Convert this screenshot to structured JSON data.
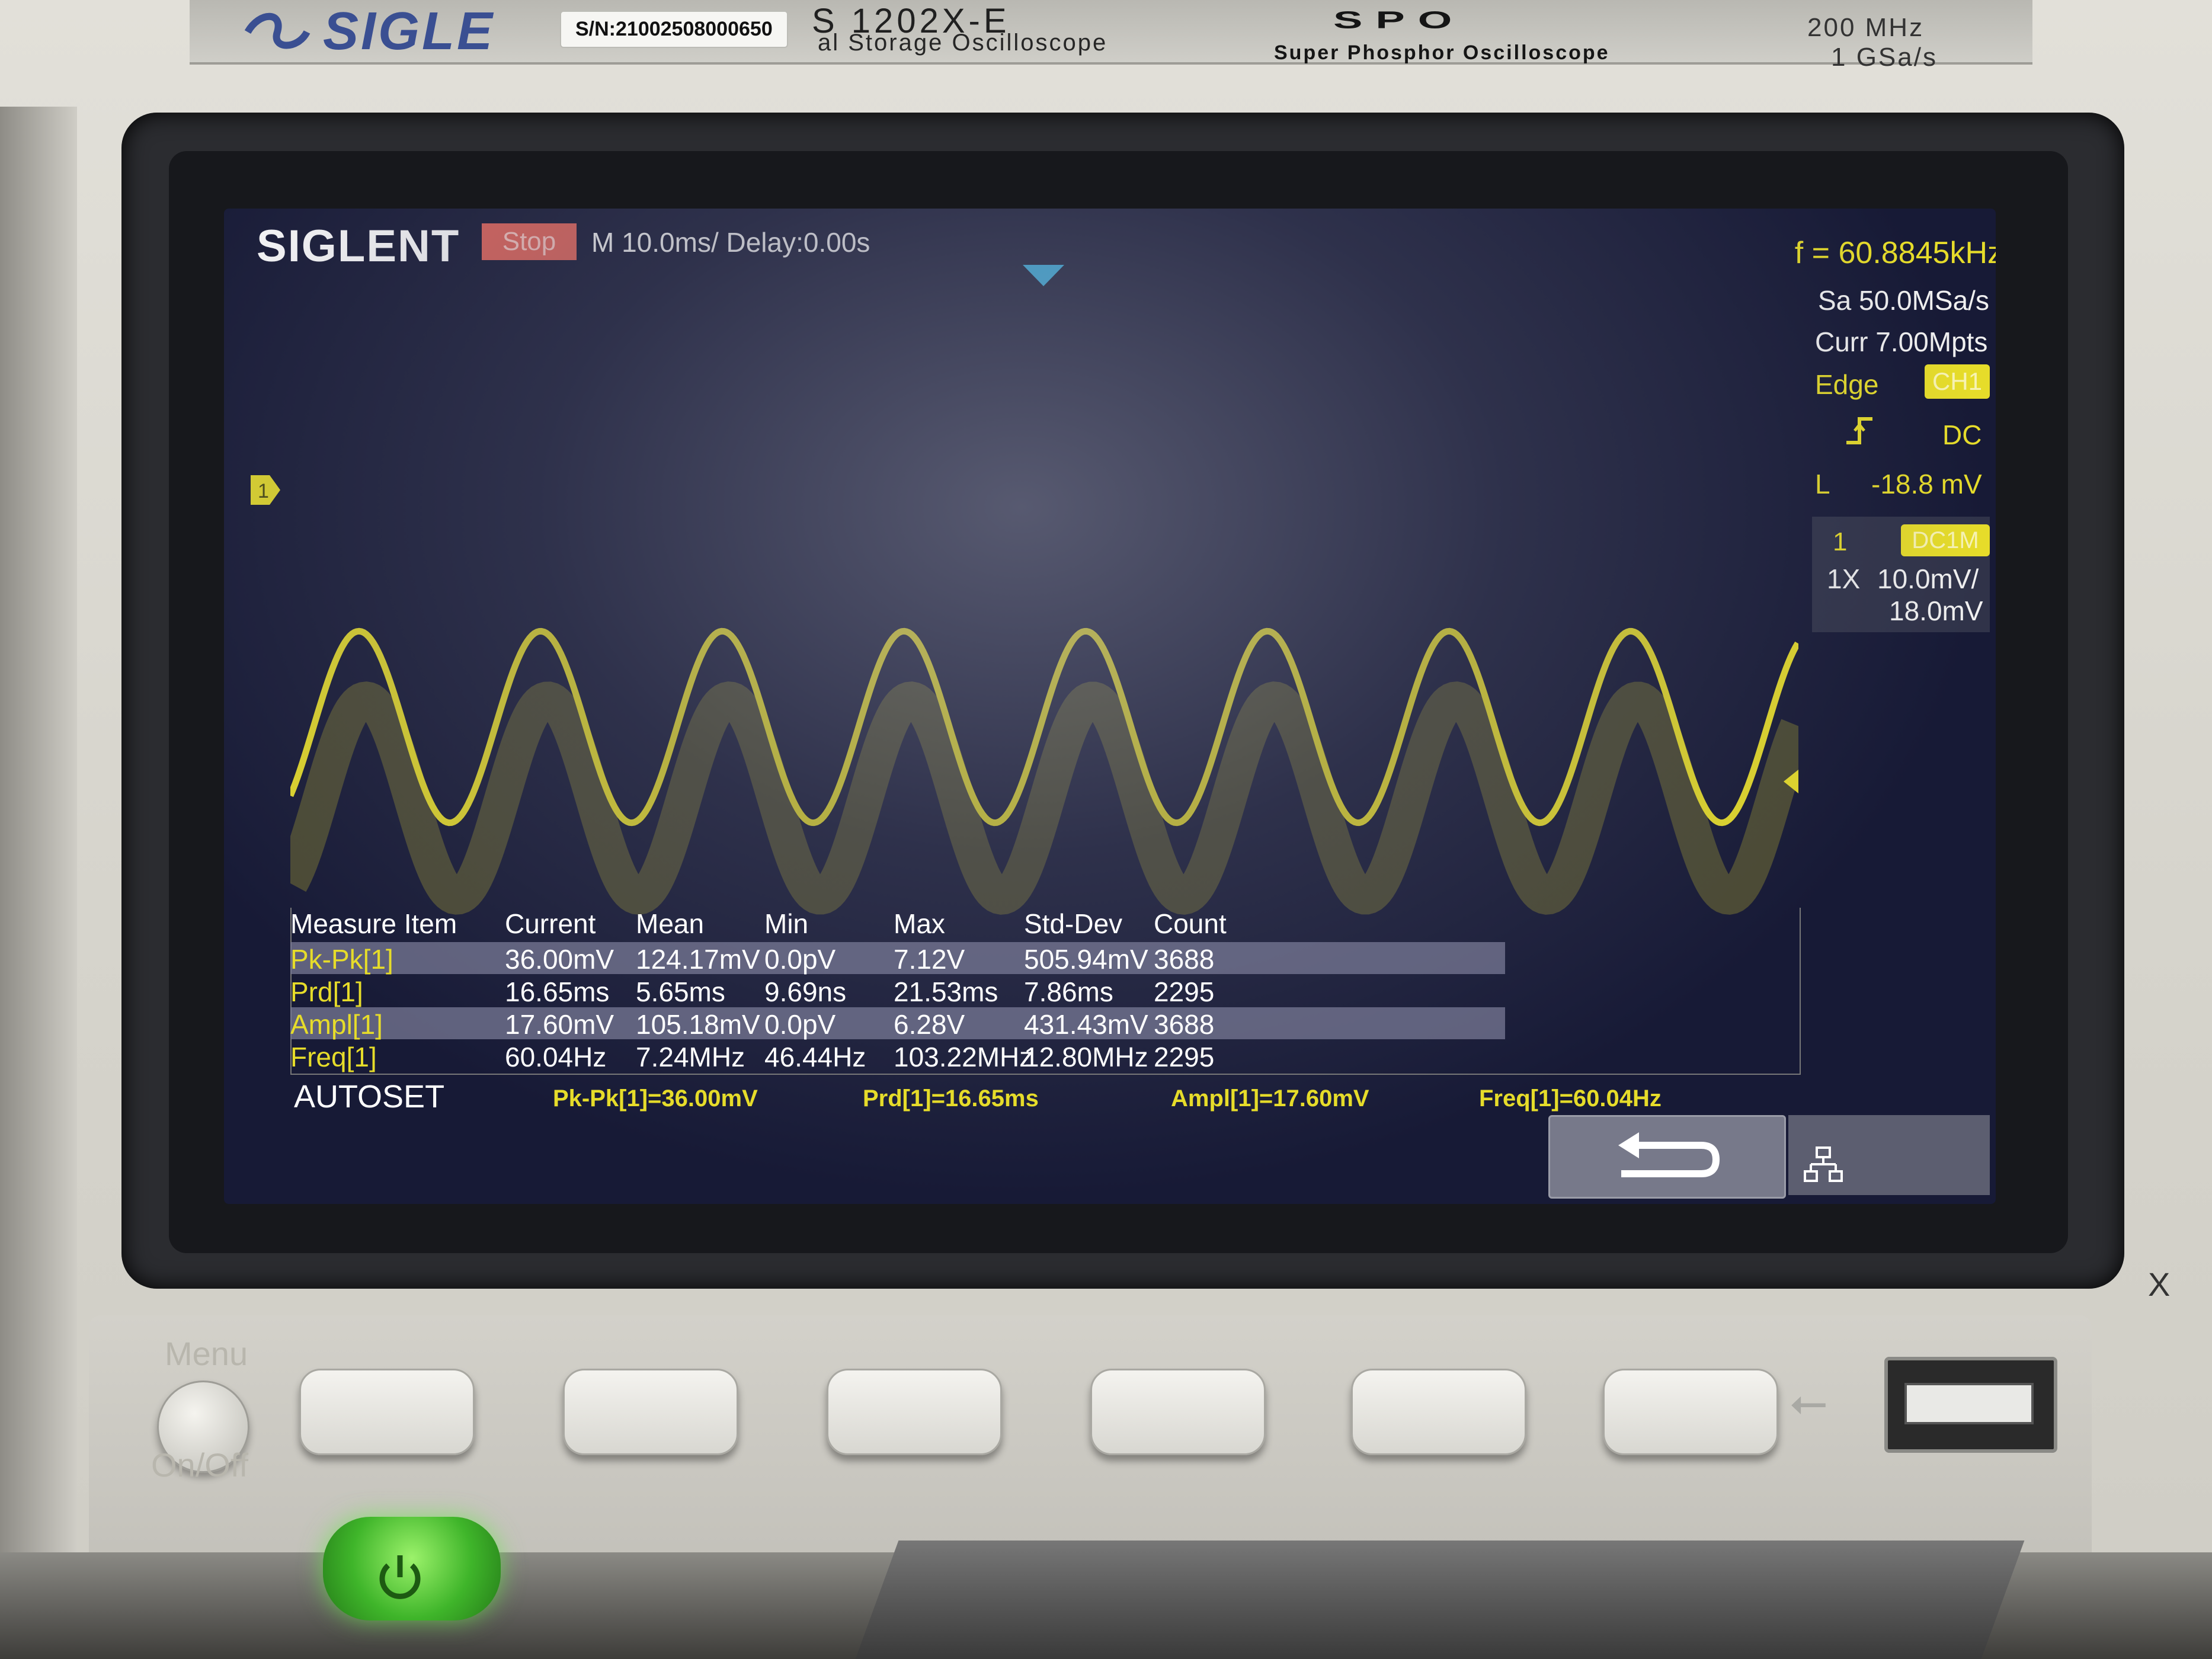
{
  "instrument": {
    "brand": "SIGLE",
    "serial": "S/N:21002508000650",
    "model": "S 1202X-E",
    "model_desc": "al Storage Oscilloscope",
    "spo_logo": "SPO",
    "spo_sub": "Super Phosphor Oscilloscope",
    "bandwidth": "200 MHz",
    "sample_rate_spec": "1 GSa/s"
  },
  "screen": {
    "logo": "SIGLENT",
    "run_state": "Stop",
    "timebase": "M 10.0ms/ Delay:0.00s",
    "freq_counter": "f = 60.8845kHz",
    "sample_rate": "Sa 50.0MSa/s",
    "memory_depth": "Curr 7.00Mpts",
    "trigger": {
      "type": "Edge",
      "source": "CH1",
      "slope_icon": "rising-edge-icon",
      "coupling": "DC",
      "level_label": "L",
      "level": "-18.8 mV"
    },
    "channel": {
      "number": "1",
      "coupling": "DC1M",
      "probe": "1X",
      "scale": "10.0mV/",
      "offset": "18.0mV"
    },
    "ch1_marker": "1",
    "waveform": {
      "color": "#e6dc2a",
      "cycles_visible": 8.3
    }
  },
  "measure": {
    "headers": [
      "Measure Item",
      "Current",
      "Mean",
      "Min",
      "Max",
      "Std-Dev",
      "Count"
    ],
    "rows": [
      [
        "Pk-Pk[1]",
        "36.00mV",
        "124.17mV",
        "0.0pV",
        "7.12V",
        "505.94mV",
        "3688"
      ],
      [
        "Prd[1]",
        "16.65ms",
        "5.65ms",
        "9.69ns",
        "21.53ms",
        "7.86ms",
        "2295"
      ],
      [
        "Ampl[1]",
        "17.60mV",
        "105.18mV",
        "0.0pV",
        "6.28V",
        "431.43mV",
        "3688"
      ],
      [
        "Freq[1]",
        "60.04Hz",
        "7.24MHz",
        "46.44Hz",
        "103.22MHz",
        "12.80MHz",
        "2295"
      ]
    ]
  },
  "bottom_bar": {
    "autoset": "AUTOSET",
    "quick": [
      "Pk-Pk[1]=36.00mV",
      "Prd[1]=16.65ms",
      "Ampl[1]=17.60mV",
      "Freq[1]=60.04Hz"
    ]
  },
  "front_panel": {
    "menu_label": "Menu",
    "onoff_label": "On/Off",
    "x_label": "X"
  },
  "colors": {
    "trace": "#e6dc2a",
    "screen_bg": "#171a36",
    "stop": "#e0645a",
    "power": "#3fb52a"
  }
}
